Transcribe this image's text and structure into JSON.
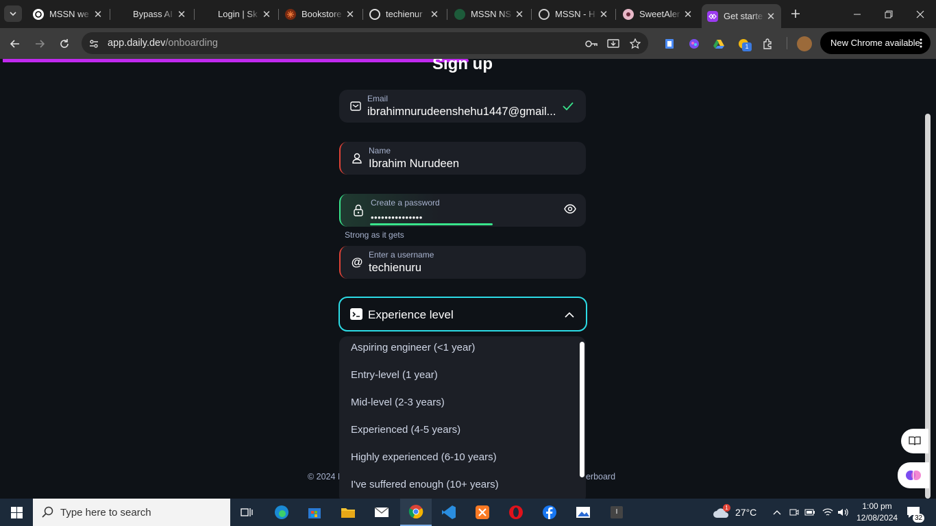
{
  "browser": {
    "tabs": [
      {
        "title": "MSSN we",
        "icon": "openai-icon"
      },
      {
        "title": "Bypass AI",
        "icon": "none"
      },
      {
        "title": "Login | Sk",
        "icon": "none"
      },
      {
        "title": "Bookstore",
        "icon": "bookstore-icon"
      },
      {
        "title": "techienur",
        "icon": "github-icon"
      },
      {
        "title": "MSSN NS",
        "icon": "mssn-icon"
      },
      {
        "title": "MSSN - H",
        "icon": "globe-icon"
      },
      {
        "title": "SweetAler",
        "icon": "sweetalert-icon"
      },
      {
        "title": "Get starte",
        "icon": "daily-dev-icon",
        "active": true
      }
    ],
    "url_host": "app.daily.dev",
    "url_path": "/onboarding",
    "new_chrome_label": "New Chrome available",
    "profile_badge": "1"
  },
  "page": {
    "title": "Sign up",
    "email": {
      "label": "Email",
      "value": "ibrahimnurudeenshehu1447@gmail..."
    },
    "name": {
      "label": "Name",
      "value": "Ibrahim Nurudeen"
    },
    "password": {
      "label": "Create a password",
      "value": "•••••••••••••••",
      "strength_hint": "Strong as it gets",
      "strength": 0.57
    },
    "username": {
      "label": "Enter a username",
      "value": "techienuru"
    },
    "experience": {
      "placeholder": "Experience level",
      "options": [
        "Aspiring engineer (<1 year)",
        "Entry-level (1 year)",
        "Mid-level (2-3 years)",
        "Experienced (4-5 years)",
        "Highly experienced (6-10 years)",
        "I've suffered enough (10+ years)"
      ]
    },
    "footer_left": "© 2024 D",
    "footer_right": "derboard"
  },
  "colors": {
    "accent_progress": "#c029f0",
    "focus": "#2cdce6",
    "error": "#e04337",
    "success": "#39e58c"
  },
  "taskbar": {
    "search_placeholder": "Type here to search",
    "weather": "27°C",
    "weather_badge": "1",
    "time": "1:00 pm",
    "date": "12/08/2024",
    "notification_count": "32"
  }
}
